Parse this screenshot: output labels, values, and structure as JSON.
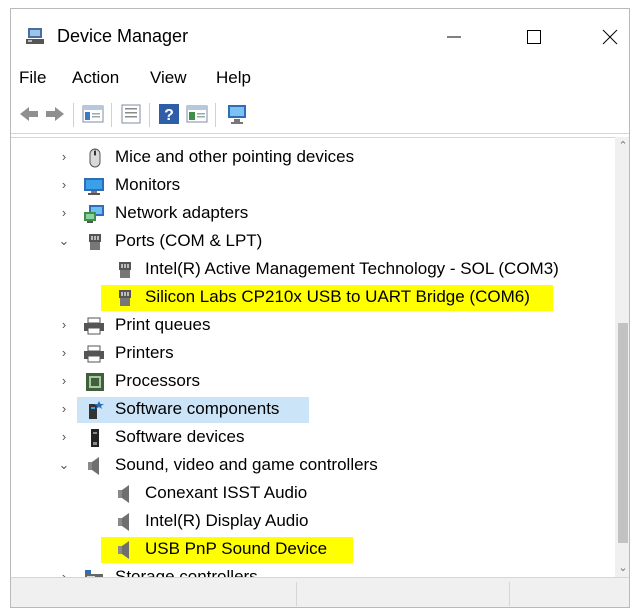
{
  "window": {
    "title": "Device Manager",
    "icons": {
      "app": "device-manager-icon",
      "minimize": "minimize-icon",
      "maximize": "maximize-icon",
      "close": "close-icon"
    }
  },
  "menu": [
    "File",
    "Action",
    "View",
    "Help"
  ],
  "toolbar": [
    "back-icon",
    "forward-icon",
    "show-hide-console-tree-icon",
    "properties-icon",
    "help-icon",
    "update-driver-icon",
    "monitor-icon"
  ],
  "tree": {
    "items": [
      {
        "label": "Mice and other pointing devices",
        "icon": "mouse-icon",
        "expanded": false
      },
      {
        "label": "Monitors",
        "icon": "monitor-icon",
        "expanded": false
      },
      {
        "label": "Network adapters",
        "icon": "network-adapter-icon",
        "expanded": false
      },
      {
        "label": "Ports (COM & LPT)",
        "icon": "port-icon",
        "expanded": true
      },
      {
        "label": "Intel(R) Active Management Technology - SOL (COM3)",
        "icon": "port-icon",
        "child": true
      },
      {
        "label": "Silicon Labs CP210x USB to UART Bridge (COM6)",
        "icon": "port-icon",
        "child": true,
        "highlight": "yellow"
      },
      {
        "label": "Print queues",
        "icon": "printer-icon",
        "expanded": false
      },
      {
        "label": "Printers",
        "icon": "printer-icon",
        "expanded": false
      },
      {
        "label": "Processors",
        "icon": "processor-icon",
        "expanded": false
      },
      {
        "label": "Software components",
        "icon": "software-component-icon",
        "expanded": false,
        "highlight": "blue"
      },
      {
        "label": "Software devices",
        "icon": "software-device-icon",
        "expanded": false
      },
      {
        "label": "Sound, video and game controllers",
        "icon": "speaker-icon",
        "expanded": true
      },
      {
        "label": "Conexant ISST Audio",
        "icon": "speaker-icon",
        "child": true
      },
      {
        "label": "Intel(R) Display Audio",
        "icon": "speaker-icon",
        "child": true
      },
      {
        "label": "USB PnP Sound Device",
        "icon": "speaker-icon",
        "child": true,
        "highlight": "yellow"
      },
      {
        "label": "Storage controllers",
        "icon": "storage-controller-icon",
        "expanded": false
      }
    ]
  },
  "colors": {
    "highlight_yellow": "#ffff00",
    "highlight_blue": "#cce4f7"
  }
}
